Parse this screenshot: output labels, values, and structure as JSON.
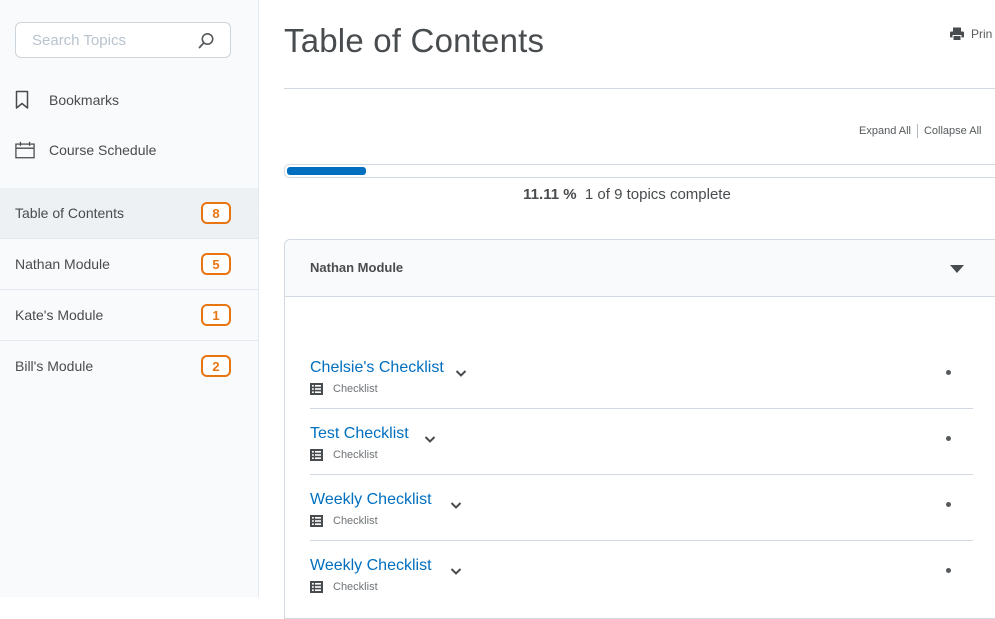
{
  "sidebar": {
    "search": {
      "placeholder": "Search Topics",
      "value": ""
    },
    "links": [
      {
        "label": "Bookmarks",
        "icon": "bookmark-icon"
      },
      {
        "label": "Course Schedule",
        "icon": "calendar-icon"
      }
    ],
    "modules": [
      {
        "label": "Table of Contents",
        "count": "8",
        "active": true
      },
      {
        "label": "Nathan Module",
        "count": "5"
      },
      {
        "label": "Kate's Module",
        "count": "1"
      },
      {
        "label": "Bill's Module",
        "count": "2"
      }
    ]
  },
  "main": {
    "title": "Table of Contents",
    "print_label": "Prin",
    "expand_all": "Expand All",
    "collapse_all": "Collapse All",
    "progress": {
      "percent_text": "11.11 %",
      "summary": "1 of 9 topics complete",
      "fraction": 0.1111
    },
    "module": {
      "name": "Nathan Module",
      "topics": [
        {
          "title": "Chelsie's Checklist",
          "type": "Checklist"
        },
        {
          "title": "Test Checklist",
          "type": "Checklist"
        },
        {
          "title": "Weekly Checklist",
          "type": "Checklist"
        },
        {
          "title": "Weekly Checklist",
          "type": "Checklist"
        }
      ]
    }
  },
  "colors": {
    "accent": "#006fbf",
    "badge": "#e87511",
    "text": "#494c4e",
    "border": "#d3d9e3"
  }
}
